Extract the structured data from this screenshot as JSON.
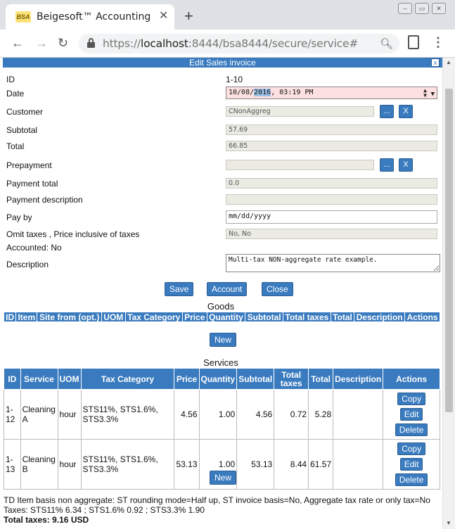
{
  "browser": {
    "tab_title": "Beigesoft™ Accounting",
    "favicon_text": "BSA",
    "url_host": "localhost",
    "url_scheme": "https://",
    "url_rest": ":8444/bsa8444/secure/service#"
  },
  "dialog": {
    "title": "Edit Sales invoice",
    "close_label": "x"
  },
  "form": {
    "id_label": "ID",
    "id_value": "1-10",
    "date_label": "Date",
    "date_pre": "10/08/",
    "date_sel": "2016",
    "date_post": ", 03:19 PM",
    "customer_label": "Customer",
    "customer_value": "CNonAggreg",
    "subtotal_label": "Subtotal",
    "subtotal_value": "57.69",
    "total_label": "Total",
    "total_value": "66.85",
    "prepayment_label": "Prepayment",
    "prepayment_value": "",
    "payment_total_label": "Payment total",
    "payment_total_value": "0.0",
    "payment_desc_label": "Payment description",
    "payment_desc_value": "",
    "pay_by_label": "Pay by",
    "pay_by_value": "mm/dd/yyyy",
    "omit_label": "Omit taxes , Price inclusive of taxes",
    "omit_value": "No, No",
    "accounted_label": "Accounted: No",
    "description_label": "Description",
    "description_value": "Multi-tax NON-aggregate rate example.",
    "select_button": "...",
    "clear_button": "X"
  },
  "actions": {
    "save": "Save",
    "account": "Account",
    "close": "Close"
  },
  "goods": {
    "title": "Goods",
    "columns": [
      "ID",
      "Item",
      "Site from (opt.)",
      "UOM",
      "Tax Category",
      "Price",
      "Quantity",
      "Subtotal",
      "Total taxes",
      "Total",
      "Description",
      "Actions"
    ],
    "new_button": "New"
  },
  "services": {
    "title": "Services",
    "columns": [
      "ID",
      "Service",
      "UOM",
      "Tax Category",
      "Price",
      "Quantity",
      "Subtotal",
      "Total taxes",
      "Total",
      "Description",
      "Actions"
    ],
    "rows": [
      {
        "id": "1-12",
        "service": "Cleaning A",
        "uom": "hour",
        "tax_category": "STS11%, STS1.6%, STS3.3%",
        "price": "4.56",
        "quantity": "1.00",
        "subtotal": "4.56",
        "total_taxes": "0.72",
        "total": "5.28",
        "description": ""
      },
      {
        "id": "1-13",
        "service": "Cleaning B",
        "uom": "hour",
        "tax_category": "STS11%, STS1.6%, STS3.3%",
        "price": "53.13",
        "quantity": "1.00",
        "subtotal": "53.13",
        "total_taxes": "8.44",
        "total": "61.57",
        "description": ""
      }
    ],
    "copy_button": "Copy",
    "edit_button": "Edit",
    "delete_button": "Delete",
    "new_button": "New"
  },
  "footer": {
    "td_line": "TD Item basis non aggregate: ST rounding mode=Half up, ST invoice basis=No, Aggregate tax rate or only tax=No",
    "taxes_line": "Taxes: STS11% 6.34 ; STS1.6% 0.92 ; STS3.3% 1.90",
    "total_taxes_line": "Total taxes: 9.16 USD"
  },
  "colors": {
    "accent": "#3a7bbf",
    "date_invalid_bg": "#fde0e0"
  }
}
